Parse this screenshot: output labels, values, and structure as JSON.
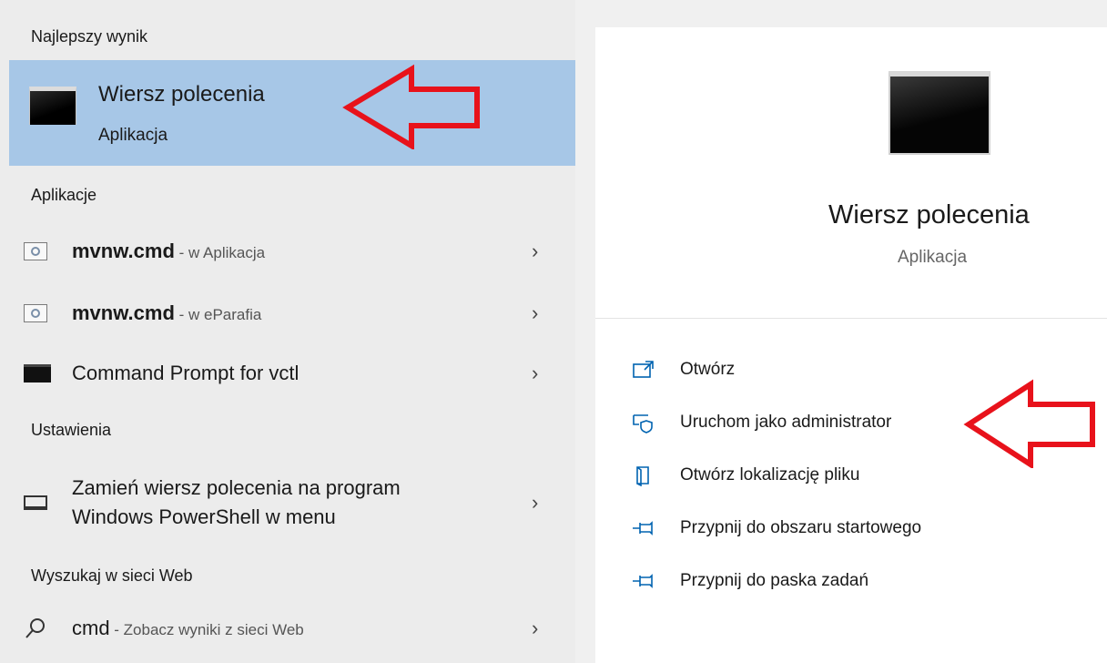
{
  "left": {
    "best_header": "Najlepszy wynik",
    "best": {
      "title": "Wiersz polecenia",
      "subtitle": "Aplikacja"
    },
    "apps_header": "Aplikacje",
    "apps": [
      {
        "name": "mvnw.cmd",
        "location": " - w Aplikacja"
      },
      {
        "name": "mvnw.cmd",
        "location": " - w eParafia"
      },
      {
        "name": "Command Prompt for vctl",
        "location": ""
      }
    ],
    "settings_header": "Ustawienia",
    "settings": [
      {
        "line1": "Zamień wiersz polecenia na program",
        "line2": "Windows PowerShell w menu"
      }
    ],
    "web_header": "Wyszukaj w sieci Web",
    "web": {
      "query": "cmd",
      "suffix": " - Zobacz wyniki z sieci Web"
    },
    "chevron": "›"
  },
  "right": {
    "title": "Wiersz polecenia",
    "subtitle": "Aplikacja",
    "actions": [
      {
        "label": "Otwórz",
        "icon": "open-icon"
      },
      {
        "label": "Uruchom jako administrator",
        "icon": "shield-admin-icon"
      },
      {
        "label": "Otwórz lokalizację pliku",
        "icon": "file-location-icon"
      },
      {
        "label": "Przypnij do obszaru startowego",
        "icon": "pin-icon"
      },
      {
        "label": "Przypnij do paska zadań",
        "icon": "pin-icon"
      }
    ]
  },
  "colors": {
    "selected": "#a7c7e7",
    "accent": "#0063b1",
    "annotation": "#e8121b"
  }
}
